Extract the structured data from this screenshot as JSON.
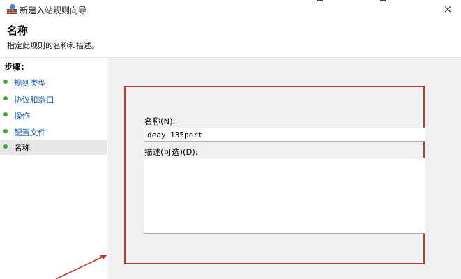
{
  "window": {
    "title": "新建入站规则向导",
    "close_glyph": "×"
  },
  "header": {
    "title": "名称",
    "subtitle": "指定此规则的名称和描述。"
  },
  "sidebar": {
    "steps_label": "步骤:",
    "items": [
      {
        "label": "规则类型"
      },
      {
        "label": "协议和端口"
      },
      {
        "label": "操作"
      },
      {
        "label": "配置文件"
      },
      {
        "label": "名称"
      }
    ],
    "active_index": 4
  },
  "form": {
    "name_label": "名称(N):",
    "name_value": "deay 135port",
    "desc_label": "描述(可选)(D):",
    "desc_value": ""
  },
  "colors": {
    "highlight_border": "#c0392b",
    "step_dot": "#3aa83a",
    "step_link": "#1a5fb4"
  }
}
